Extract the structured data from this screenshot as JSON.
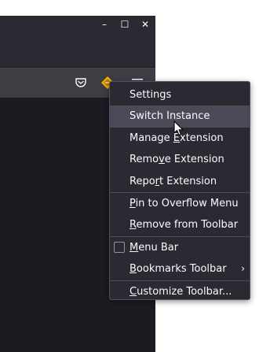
{
  "window": {
    "controls": [
      "–",
      "☐",
      "✕"
    ]
  },
  "context_menu": {
    "items": [
      {
        "label": "Settings"
      },
      {
        "label": "Switch Instance",
        "hover": true
      },
      {
        "pre": "Manage ",
        "ul": "E",
        "post": "xtension"
      },
      {
        "pre": "Remo",
        "ul": "v",
        "post": "e Extension"
      },
      {
        "pre": "Repo",
        "ul": "r",
        "post": "t Extension"
      },
      {
        "pre": "",
        "ul": "P",
        "post": "in to Overflow Menu"
      },
      {
        "pre": "",
        "ul": "R",
        "post": "emove from Toolbar"
      },
      {
        "pre": "",
        "ul": "M",
        "post": "enu Bar"
      },
      {
        "pre": "",
        "ul": "B",
        "post": "ookmarks Toolbar"
      },
      {
        "pre": "",
        "ul": "C",
        "post": "ustomize Toolbar..."
      }
    ],
    "submenu_arrow": "›"
  },
  "colors": {
    "extension_icon": "#f0b400",
    "menu_bg": "#2b2a33",
    "hover_bg": "#4b4a58"
  },
  "icons": {
    "pocket": "pocket-icon",
    "extension": "extension-icon",
    "app_menu": "hamburger-menu-icon"
  }
}
